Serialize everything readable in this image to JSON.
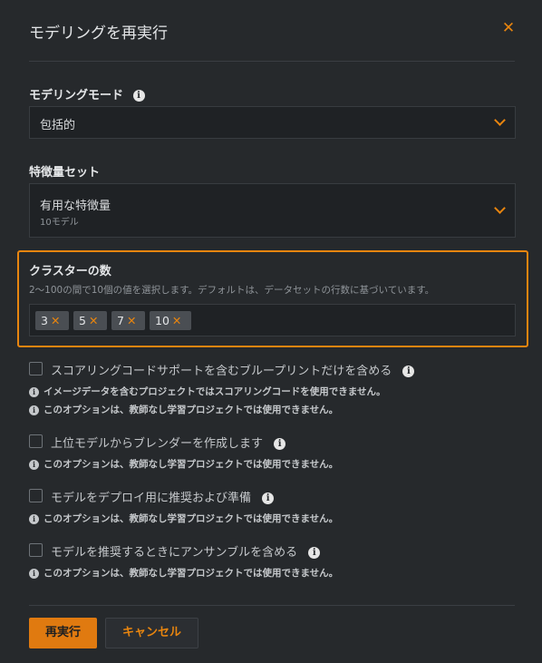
{
  "dialog": {
    "title": "モデリングを再実行",
    "close_glyph": "✕"
  },
  "modeling_mode": {
    "label": "モデリングモード",
    "icon": "info-icon",
    "value": "包括的"
  },
  "feature_set": {
    "label": "特徴量セット",
    "value": "有用な特徴量",
    "sub": "10モデル"
  },
  "clusters": {
    "label": "クラスターの数",
    "hint": "2〜100の間で10個の値を選択します。デフォルトは、データセットの行数に基づいています。",
    "tags": [
      "3",
      "5",
      "7",
      "10"
    ],
    "remove_glyph": "✕"
  },
  "options": [
    {
      "label": "スコアリングコードサポートを含むブループリントだけを含める",
      "checked": false,
      "notes": [
        "イメージデータを含むプロジェクトではスコアリングコードを使用できません。",
        "このオプションは、教師なし学習プロジェクトでは使用できません。"
      ]
    },
    {
      "label": "上位モデルからブレンダーを作成します",
      "checked": false,
      "notes": [
        "このオプションは、教師なし学習プロジェクトでは使用できません。"
      ]
    },
    {
      "label": "モデルをデプロイ用に推奨および準備",
      "checked": false,
      "notes": [
        "このオプションは、教師なし学習プロジェクトでは使用できません。"
      ]
    },
    {
      "label": "モデルを推奨するときにアンサンブルを含める",
      "checked": false,
      "notes": [
        "このオプションは、教師なし学習プロジェクトでは使用できません。"
      ]
    }
  ],
  "footer": {
    "primary_label": "再実行",
    "cancel_label": "キャンセル"
  },
  "colors": {
    "accent": "#e8850f",
    "background": "#26292c",
    "field": "#1f2225"
  }
}
